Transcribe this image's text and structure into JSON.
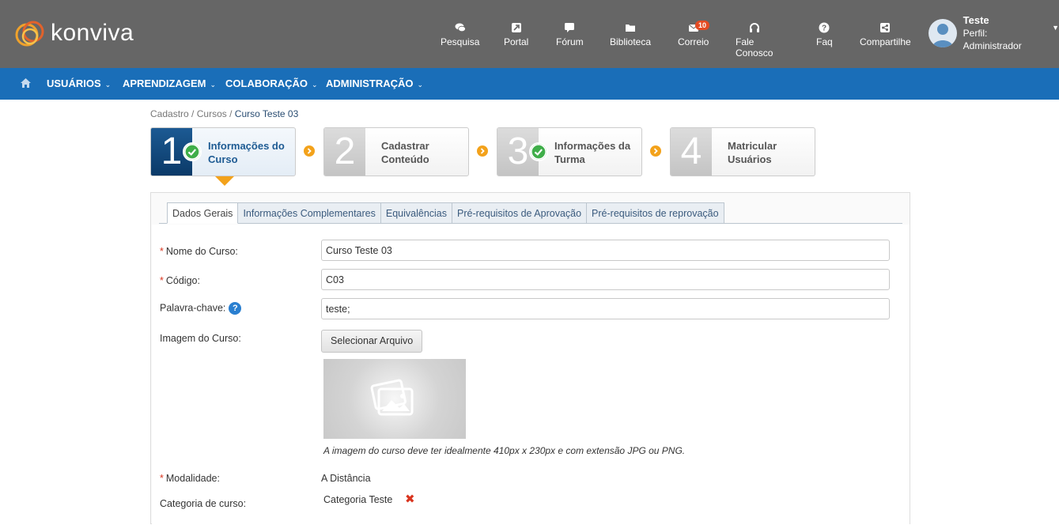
{
  "brand": {
    "name": "konviva"
  },
  "topnav": [
    {
      "label": "Pesquisa",
      "icon": "search-chat-icon"
    },
    {
      "label": "Portal",
      "icon": "portal-icon"
    },
    {
      "label": "Fórum",
      "icon": "forum-icon"
    },
    {
      "label": "Biblioteca",
      "icon": "folder-icon"
    },
    {
      "label": "Correio",
      "icon": "mail-icon",
      "badge": "10"
    },
    {
      "label": "Fale Conosco",
      "icon": "headset-icon"
    },
    {
      "label": "Faq",
      "icon": "question-icon"
    },
    {
      "label": "Compartilhe",
      "icon": "share-icon"
    }
  ],
  "user": {
    "name": "Teste",
    "role": "Perfil: Administrador"
  },
  "menu": [
    {
      "label": "USUÁRIOS"
    },
    {
      "label": "APRENDIZAGEM"
    },
    {
      "label": "COLABORAÇÃO"
    },
    {
      "label": "ADMINISTRAÇÃO"
    }
  ],
  "breadcrumb": {
    "part1": "Cadastro",
    "part2": "Cursos",
    "current": "Curso Teste 03",
    "sep": "/"
  },
  "steps": [
    {
      "num": "1",
      "label": "Informações do Curso",
      "done": true,
      "active": true
    },
    {
      "num": "2",
      "label": "Cadastrar Conteúdo",
      "done": false,
      "active": false
    },
    {
      "num": "3",
      "label": "Informações da Turma",
      "done": true,
      "active": false
    },
    {
      "num": "4",
      "label": "Matricular Usuários",
      "done": false,
      "active": false
    }
  ],
  "tabs": [
    {
      "label": "Dados Gerais",
      "active": true
    },
    {
      "label": "Informações Complementares",
      "active": false
    },
    {
      "label": "Equivalências",
      "active": false
    },
    {
      "label": "Pré-requisitos de Aprovação",
      "active": false
    },
    {
      "label": "Pré-requisitos de reprovação",
      "active": false
    }
  ],
  "form": {
    "nome_label": "Nome do Curso:",
    "nome_value": "Curso Teste 03",
    "codigo_label": "Código:",
    "codigo_value": "C03",
    "palavra_label": "Palavra-chave:",
    "palavra_value": "teste;",
    "help_glyph": "?",
    "imagem_label": "Imagem do Curso:",
    "select_file_label": "Selecionar Arquivo",
    "image_note": "A imagem do curso deve ter idealmente 410px x 230px e com extensão JPG ou PNG.",
    "modalidade_label": "Modalidade:",
    "modalidade_value": "A Distância",
    "categoria_label": "Categoria de curso:",
    "categoria_value": "Categoria Teste",
    "required_mark": "*",
    "remove_glyph": "✖"
  },
  "colors": {
    "header": "#666666",
    "menu": "#1a6eb8",
    "accent": "#f3a21b",
    "check": "#3fae49"
  }
}
